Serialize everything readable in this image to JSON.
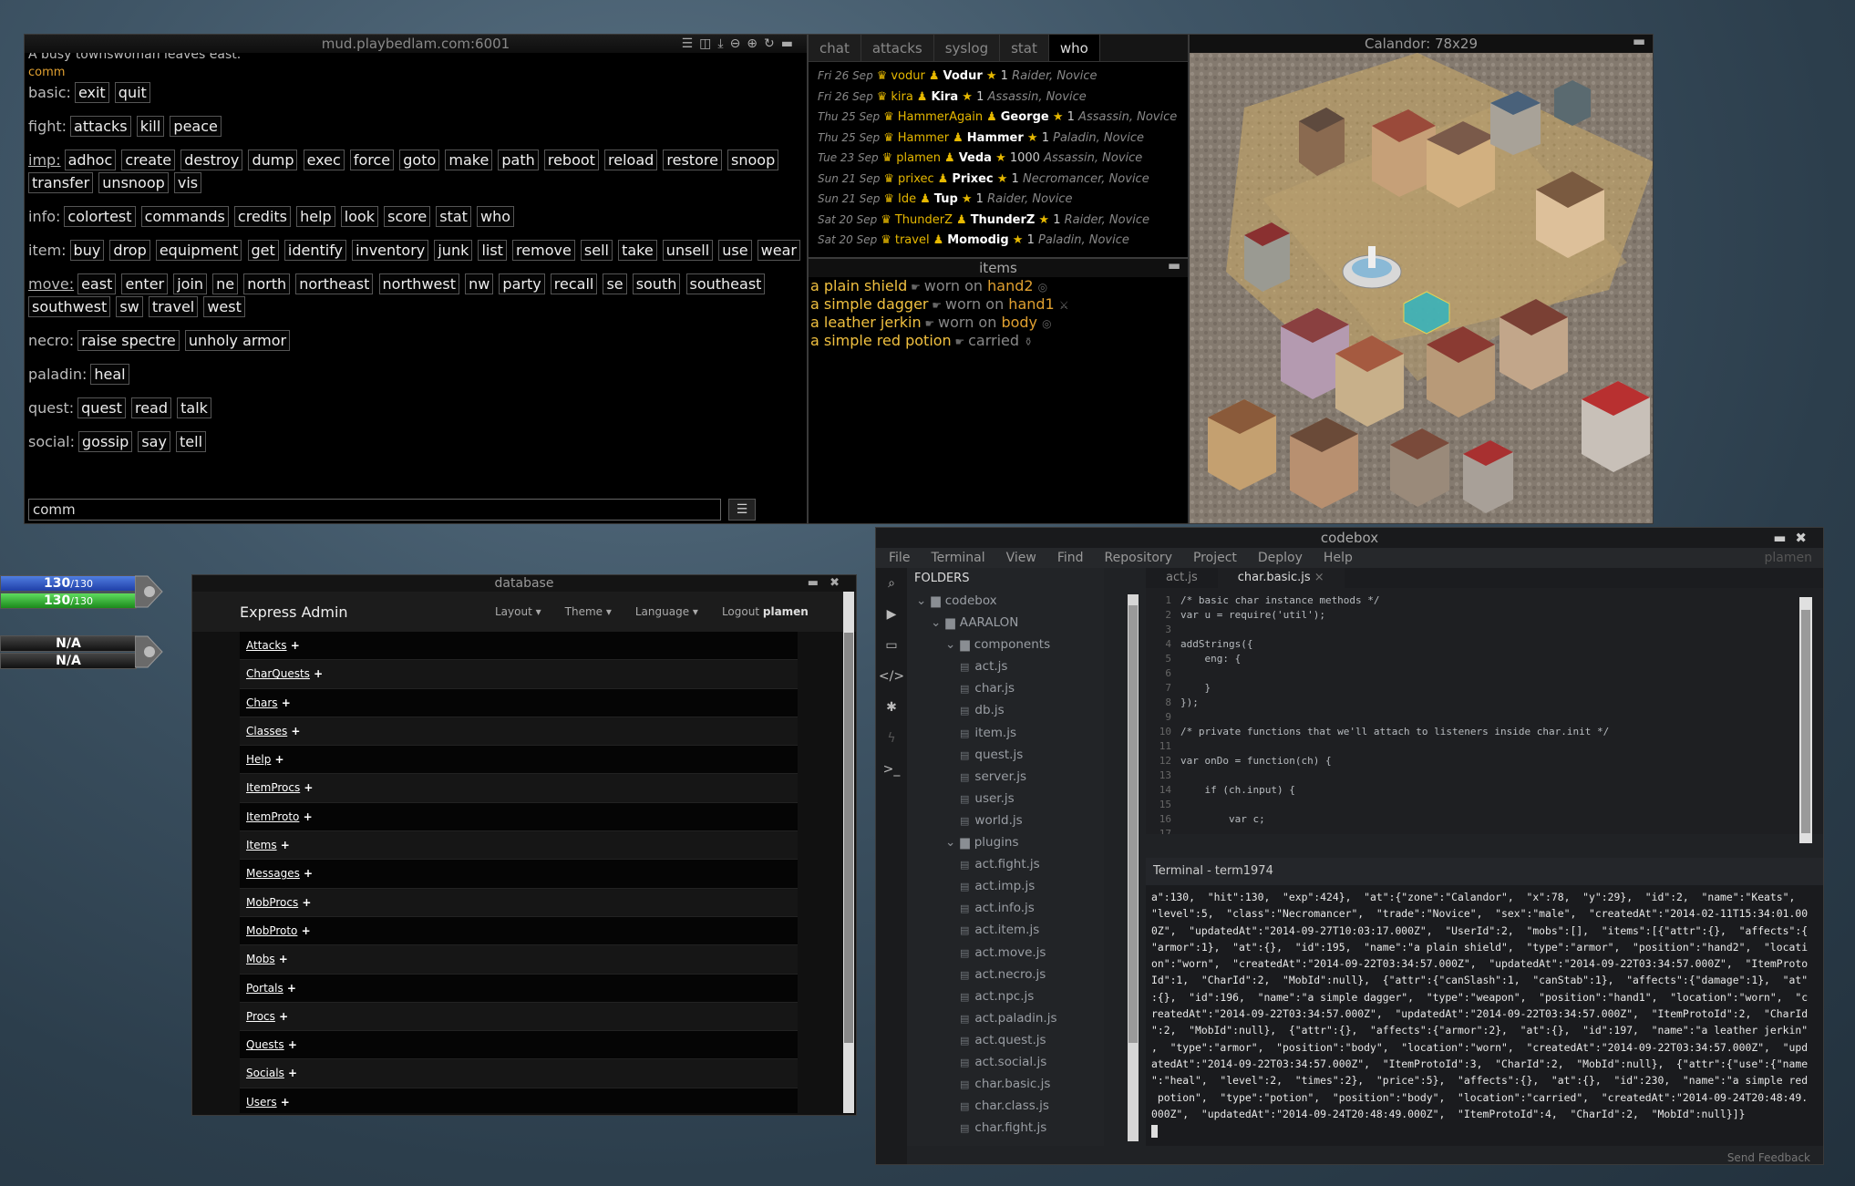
{
  "mud": {
    "title": "mud.playbedlam.com:6001",
    "status_line": "A busy townswoman leaves east.",
    "comm_label": "comm",
    "input_value": "comm",
    "groups": [
      {
        "label": "basic:",
        "cmds": [
          "exit",
          "quit"
        ]
      },
      {
        "label": "fight:",
        "cmds": [
          "attacks",
          "kill",
          "peace"
        ]
      },
      {
        "label": "imp:",
        "cmds": [
          "adhoc",
          "create",
          "destroy",
          "dump",
          "exec",
          "force",
          "goto",
          "make",
          "path",
          "reboot",
          "reload",
          "restore",
          "snoop",
          "transfer",
          "unsnoop",
          "vis"
        ]
      },
      {
        "label": "info:",
        "cmds": [
          "colortest",
          "commands",
          "credits",
          "help",
          "look",
          "score",
          "stat",
          "who"
        ]
      },
      {
        "label": "item:",
        "cmds": [
          "buy",
          "drop",
          "equipment",
          "get",
          "identify",
          "inventory",
          "junk",
          "list",
          "remove",
          "sell",
          "take",
          "unsell",
          "use",
          "wear"
        ]
      },
      {
        "label": "move:",
        "cmds": [
          "east",
          "enter",
          "join",
          "ne",
          "north",
          "northeast",
          "northwest",
          "nw",
          "party",
          "recall",
          "se",
          "south",
          "southeast",
          "southwest",
          "sw",
          "travel",
          "west"
        ]
      },
      {
        "label": "necro:",
        "cmds": [
          "raise spectre",
          "unholy armor"
        ]
      },
      {
        "label": "paladin:",
        "cmds": [
          "heal"
        ]
      },
      {
        "label": "quest:",
        "cmds": [
          "quest",
          "read",
          "talk"
        ]
      },
      {
        "label": "social:",
        "cmds": [
          "gossip",
          "say",
          "tell"
        ]
      }
    ]
  },
  "chat": {
    "tabs": [
      "chat",
      "attacks",
      "syslog",
      "stat",
      "who"
    ],
    "active_tab": "who",
    "who": [
      {
        "date": "Fri 26 Sep",
        "acct": "vodur",
        "char": "Vodur",
        "level": "1",
        "cls": "Raider, Novice"
      },
      {
        "date": "Fri 26 Sep",
        "acct": "kira",
        "char": "Kira",
        "level": "1",
        "cls": "Assassin, Novice"
      },
      {
        "date": "Thu 25 Sep",
        "acct": "HammerAgain",
        "char": "George",
        "level": "1",
        "cls": "Assassin, Novice"
      },
      {
        "date": "Thu 25 Sep",
        "acct": "Hammer",
        "char": "Hammer",
        "level": "1",
        "cls": "Paladin, Novice"
      },
      {
        "date": "Tue 23 Sep",
        "acct": "plamen",
        "char": "Veda",
        "level": "1000",
        "cls": "Assassin, Novice"
      },
      {
        "date": "Sun 21 Sep",
        "acct": "prixec",
        "char": "Prixec",
        "level": "1",
        "cls": "Necromancer, Novice"
      },
      {
        "date": "Sun 21 Sep",
        "acct": "Ide",
        "char": "Tup",
        "level": "1",
        "cls": "Raider, Novice"
      },
      {
        "date": "Sat 20 Sep",
        "acct": "ThunderZ",
        "char": "ThunderZ",
        "level": "1",
        "cls": "Raider, Novice"
      },
      {
        "date": "Sat 20 Sep",
        "acct": "travel",
        "char": "Momodig",
        "level": "1",
        "cls": "Paladin, Novice"
      }
    ]
  },
  "items": {
    "title": "items",
    "rows": [
      {
        "name": "a plain shield",
        "loc": "worn on",
        "pos": "hand2",
        "sym": "◎"
      },
      {
        "name": "a simple dagger",
        "loc": "worn on",
        "pos": "hand1",
        "sym": "⚔"
      },
      {
        "name": "a leather jerkin",
        "loc": "worn on",
        "pos": "body",
        "sym": "◎"
      },
      {
        "name": "a simple red potion",
        "loc": "carried",
        "pos": "",
        "sym": "⚱"
      }
    ]
  },
  "map": {
    "title": "Calandor: 78x29"
  },
  "bars": {
    "hp": {
      "cur": "130",
      "max": "/130",
      "fill": 1.0
    },
    "mana": {
      "cur": "130",
      "max": "/130",
      "fill": 1.0
    },
    "target1": "N/A",
    "target2": "N/A"
  },
  "db": {
    "title": "database",
    "brand": "Express Admin",
    "nav": [
      "Layout ▾",
      "Theme ▾",
      "Language ▾"
    ],
    "logout": "Logout",
    "user": "plamen",
    "tables": [
      "Attacks",
      "CharQuests",
      "Chars",
      "Classes",
      "Help",
      "ItemProcs",
      "ItemProto",
      "Items",
      "Messages",
      "MobProcs",
      "MobProto",
      "Mobs",
      "Portals",
      "Procs",
      "Quests",
      "Socials",
      "Users"
    ]
  },
  "codebox": {
    "title": "codebox",
    "menu": [
      "File",
      "Terminal",
      "View",
      "Find",
      "Repository",
      "Project",
      "Deploy",
      "Help"
    ],
    "user": "plamen",
    "folders_label": "FOLDERS",
    "tree": [
      {
        "kind": "folder",
        "depth": 0,
        "name": "codebox"
      },
      {
        "kind": "folder",
        "depth": 1,
        "name": "AARALON"
      },
      {
        "kind": "folder",
        "depth": 2,
        "name": "components"
      },
      {
        "kind": "file",
        "depth": 3,
        "name": "act.js"
      },
      {
        "kind": "file",
        "depth": 3,
        "name": "char.js"
      },
      {
        "kind": "file",
        "depth": 3,
        "name": "db.js"
      },
      {
        "kind": "file",
        "depth": 3,
        "name": "item.js"
      },
      {
        "kind": "file",
        "depth": 3,
        "name": "quest.js"
      },
      {
        "kind": "file",
        "depth": 3,
        "name": "server.js"
      },
      {
        "kind": "file",
        "depth": 3,
        "name": "user.js"
      },
      {
        "kind": "file",
        "depth": 3,
        "name": "world.js"
      },
      {
        "kind": "folder",
        "depth": 2,
        "name": "plugins"
      },
      {
        "kind": "file",
        "depth": 3,
        "name": "act.fight.js"
      },
      {
        "kind": "file",
        "depth": 3,
        "name": "act.imp.js"
      },
      {
        "kind": "file",
        "depth": 3,
        "name": "act.info.js"
      },
      {
        "kind": "file",
        "depth": 3,
        "name": "act.item.js"
      },
      {
        "kind": "file",
        "depth": 3,
        "name": "act.move.js"
      },
      {
        "kind": "file",
        "depth": 3,
        "name": "act.necro.js"
      },
      {
        "kind": "file",
        "depth": 3,
        "name": "act.npc.js"
      },
      {
        "kind": "file",
        "depth": 3,
        "name": "act.paladin.js"
      },
      {
        "kind": "file",
        "depth": 3,
        "name": "act.quest.js"
      },
      {
        "kind": "file",
        "depth": 3,
        "name": "act.social.js"
      },
      {
        "kind": "file",
        "depth": 3,
        "name": "char.basic.js"
      },
      {
        "kind": "file",
        "depth": 3,
        "name": "char.class.js"
      },
      {
        "kind": "file",
        "depth": 3,
        "name": "char.fight.js"
      }
    ],
    "tabs": [
      {
        "name": "act.js",
        "active": false
      },
      {
        "name": "char.basic.js",
        "active": true
      }
    ],
    "code": [
      "/* basic char instance methods */",
      "var u = require('util');",
      "",
      "addStrings({",
      "    eng: {",
      "",
      "    }",
      "});",
      "",
      "/* private functions that we'll attach to listeners inside char.init */",
      "",
      "var onDo = function(ch) {",
      "",
      "    if (ch.input) {",
      "",
      "        var c;",
      ""
    ],
    "terminal_title": "Terminal - term1974",
    "terminal_text": "a\":130,  \"hit\":130,  \"exp\":424},  \"at\":{\"zone\":\"Calandor\",  \"x\":78,  \"y\":29},  \"id\":2,  \"name\":\"Keats\",\n\"level\":5,  \"class\":\"Necromancer\",  \"trade\":\"Novice\",  \"sex\":\"male\",  \"createdAt\":\"2014-02-11T15:34:01.00\n0Z\",  \"updatedAt\":\"2014-09-27T10:03:17.000Z\",  \"UserId\":2,  \"mobs\":[],  \"items\":[{\"attr\":{},  \"affects\":{\n\"armor\":1},  \"at\":{},  \"id\":195,  \"name\":\"a plain shield\",  \"type\":\"armor\",  \"position\":\"hand2\",  \"locati\non\":\"worn\",  \"createdAt\":\"2014-09-22T03:34:57.000Z\",  \"updatedAt\":\"2014-09-22T03:34:57.000Z\",  \"ItemProto\nId\":1,  \"CharId\":2,  \"MobId\":null},  {\"attr\":{\"canSlash\":1,  \"canStab\":1},  \"affects\":{\"damage\":1},  \"at\"\n:{},  \"id\":196,  \"name\":\"a simple dagger\",  \"type\":\"weapon\",  \"position\":\"hand1\",  \"location\":\"worn\",  \"c\nreatedAt\":\"2014-09-22T03:34:57.000Z\",  \"updatedAt\":\"2014-09-22T03:34:57.000Z\",  \"ItemProtoId\":2,  \"CharId\n\":2,  \"MobId\":null},  {\"attr\":{},  \"affects\":{\"armor\":2},  \"at\":{},  \"id\":197,  \"name\":\"a leather jerkin\"\n,  \"type\":\"armor\",  \"position\":\"body\",  \"location\":\"worn\",  \"createdAt\":\"2014-09-22T03:34:57.000Z\",  \"upd\natedAt\":\"2014-09-22T03:34:57.000Z\",  \"ItemProtoId\":3,  \"CharId\":2,  \"MobId\":null},  {\"attr\":{\"use\":{\"name\n\":\"heal\",  \"level\":2,  \"times\":2},  \"price\":5},  \"affects\":{},  \"at\":{},  \"id\":230,  \"name\":\"a simple red\n potion\",  \"type\":\"potion\",  \"position\":\"body\",  \"location\":\"carried\",  \"createdAt\":\"2014-09-24T20:48:49.\n000Z\",  \"updatedAt\":\"2014-09-24T20:48:49.000Z\",  \"ItemProtoId\":4,  \"CharId\":2,  \"MobId\":null}]}",
    "feedback": "Send Feedback"
  }
}
